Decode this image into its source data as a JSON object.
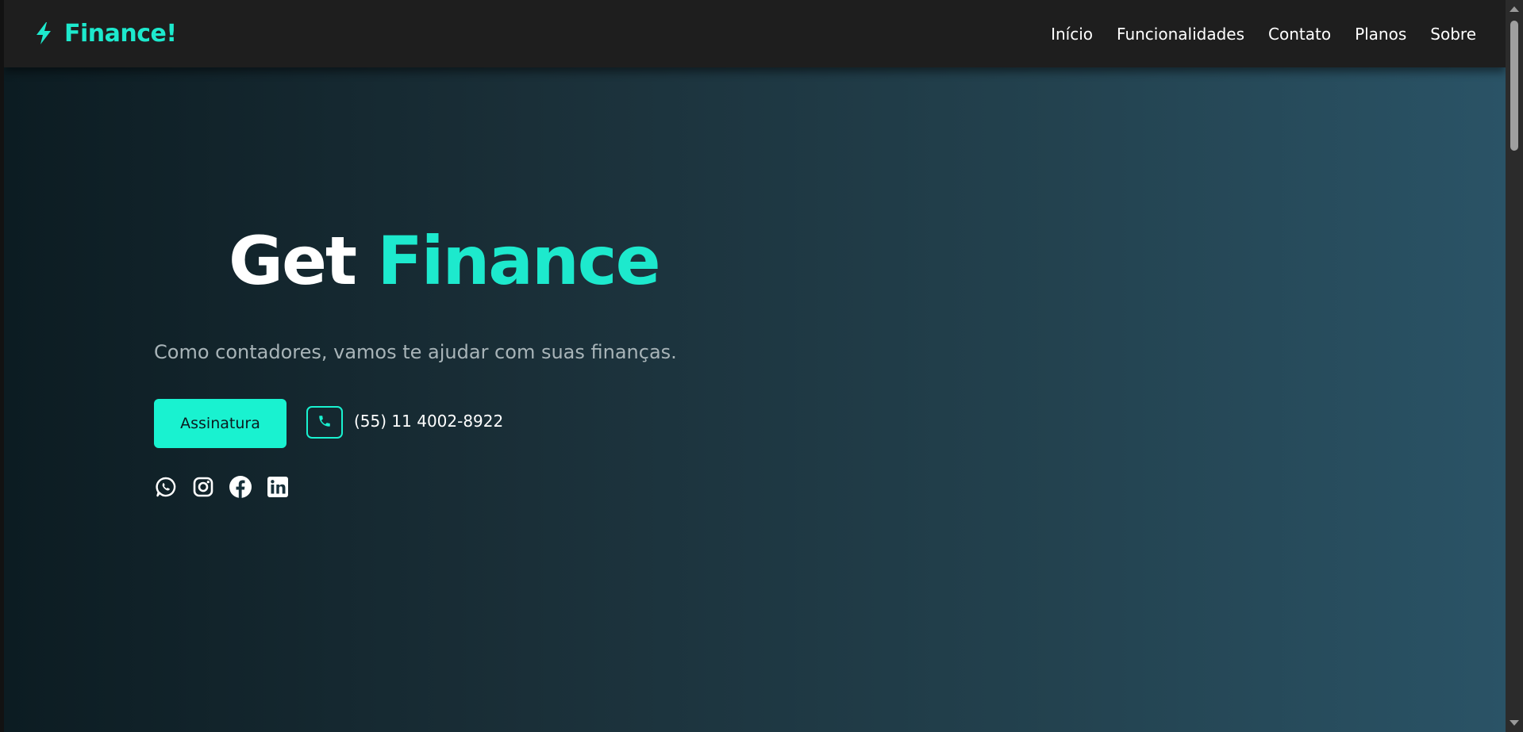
{
  "navbar": {
    "brand": {
      "icon": "lightning-bolt-icon",
      "name": "Finance!"
    },
    "links": [
      {
        "label": "Início"
      },
      {
        "label": "Funcionalidades"
      },
      {
        "label": "Contato"
      },
      {
        "label": "Planos"
      },
      {
        "label": "Sobre"
      }
    ]
  },
  "hero": {
    "title_part1": "Get",
    "title_part2": "Finance",
    "subtitle": "Como contadores, vamos te ajudar com suas finanças.",
    "cta_label": "Assinatura",
    "phone": {
      "icon": "phone-icon",
      "number": "(55) 11 4002-8922"
    },
    "socials": [
      {
        "icon": "whatsapp-icon"
      },
      {
        "icon": "instagram-icon"
      },
      {
        "icon": "facebook-icon"
      },
      {
        "icon": "linkedin-icon"
      }
    ]
  },
  "colors": {
    "accent": "#19f2d0",
    "navbar_bg": "#1e1e1e",
    "text_primary": "#ffffff",
    "text_muted": "#a8b4b8",
    "hero_gradient_start": "#0c1c22",
    "hero_gradient_end": "#2a5366"
  }
}
